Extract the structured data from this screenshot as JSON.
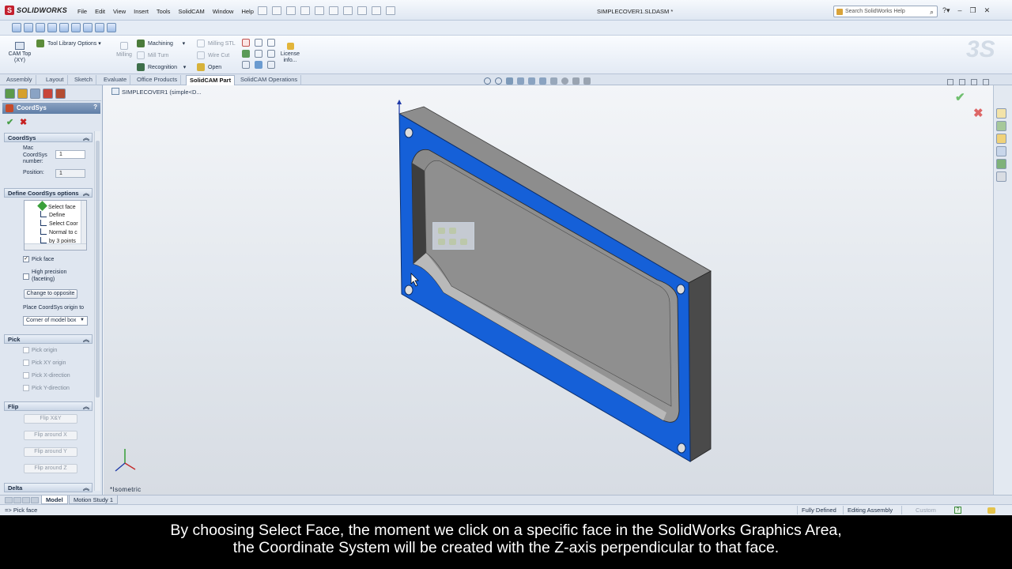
{
  "app": {
    "brand": "SOLIDWORKS",
    "menus": [
      "File",
      "Edit",
      "View",
      "Insert",
      "Tools",
      "SolidCAM",
      "Window",
      "Help"
    ],
    "document_title": "SIMPLECOVER1.SLDASM *",
    "search_placeholder": "Search SolidWorks Help"
  },
  "ribbon": {
    "cam_top": "CAM Top (XY)",
    "tool_library": "Tool Library Options",
    "milling": "Milling",
    "machining": "Machining",
    "mill_turn": "Mill Turn",
    "recognition": "Recognition",
    "milling_stl": "Milling STL",
    "wire_cut": "Wire Cut",
    "open": "Open",
    "license": "License info..."
  },
  "tabs": [
    "Assembly",
    "Layout",
    "Sketch",
    "Evaluate",
    "Office Products",
    "SolidCAM Part",
    "SolidCAM Operations"
  ],
  "active_tab": "SolidCAM Part",
  "property_manager": {
    "title": "CoordSys",
    "help": "?",
    "section_coordsys": "CoordSys",
    "mac_label": "Mac CoordSys number:",
    "mac_value": "1",
    "position_label": "Position:",
    "position_value": "1",
    "section_define": "Define CoordSys options",
    "define_options": [
      "Select face",
      "Define",
      "Select Coor",
      "Normal to c",
      "by 3 points"
    ],
    "pick_face_label": "Pick face",
    "pick_face_checked": true,
    "high_precision_label": "High precision (faceting)",
    "high_precision_checked": false,
    "change_opposite": "Change to opposite",
    "place_origin_label": "Place CoordSys origin to",
    "place_origin_value": "Corner of model box",
    "section_pick": "Pick",
    "pick_items": [
      "Pick origin",
      "Pick XY origin",
      "Pick X-direction",
      "Pick Y-direction"
    ],
    "section_flip": "Flip",
    "flip_buttons": [
      "Flip X&Y",
      "Flip around X",
      "Flip around Y",
      "Flip around Z"
    ],
    "section_delta": "Delta"
  },
  "viewport": {
    "tree_item": "SIMPLECOVER1 (simple<D...",
    "view_label": "*Isometric"
  },
  "bottom_tabs": [
    "Model",
    "Motion Study 1"
  ],
  "status": {
    "left": "=> Pick face",
    "defined": "Fully Defined",
    "mode": "Editing Assembly",
    "custom": "Custom",
    "help": "?"
  },
  "caption": {
    "line1": "By choosing Select Face, the moment we click on a specific face in the SolidWorks Graphics Area,",
    "line2": "the Coordinate System will be created with the Z-axis perpendicular to that face."
  },
  "colors": {
    "selected_face": "#1560d8",
    "part_gray": "#8e8e8e",
    "brand_red": "#c3202e"
  }
}
